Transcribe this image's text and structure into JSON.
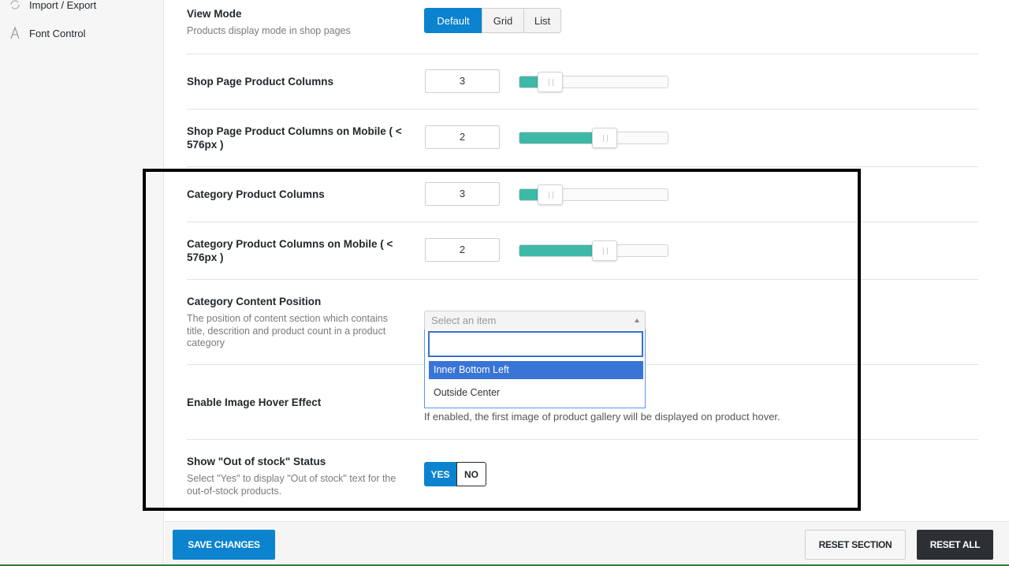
{
  "sidebar": {
    "items": [
      {
        "label": "Import / Export",
        "icon": "refresh-icon"
      },
      {
        "label": "Font Control",
        "icon": "font-icon"
      }
    ]
  },
  "settings": {
    "view_mode": {
      "label": "View Mode",
      "description": "Products display mode in shop pages",
      "options": [
        "Default",
        "Grid",
        "List"
      ],
      "selected": "Default"
    },
    "shop_cols": {
      "label": "Shop Page Product Columns",
      "value": "3",
      "fraction": 0.06
    },
    "shop_cols_mobile": {
      "label_line1": "Shop Page Product Columns on Mobile ( <",
      "label_line2": "576px )",
      "value": "2",
      "fraction": 0.5
    },
    "cat_cols": {
      "label": "Category Product Columns",
      "value": "3",
      "fraction": 0.06
    },
    "cat_cols_mobile": {
      "label_line1": "Category Product Columns on Mobile ( <",
      "label_line2": "576px )",
      "value": "2",
      "fraction": 0.5
    },
    "cat_content_position": {
      "label": "Category Content Position",
      "description_lines": [
        "The position of content section which contains",
        "title, descrition and product count in a product",
        "category"
      ],
      "placeholder": "Select an item",
      "search_value": "",
      "options": [
        "Inner Bottom Left",
        "Outside Center"
      ],
      "highlighted": "Inner Bottom Left"
    },
    "image_hover": {
      "label": "Enable Image Hover Effect",
      "help": "If enabled, the first image of product gallery will be displayed on product hover."
    },
    "out_of_stock": {
      "label": "Show \"Out of stock\" Status",
      "description_lines": [
        "Select \"Yes\" to display \"Out of stock\" text for the",
        "out-of-stock products."
      ],
      "yes_label": "YES",
      "no_label": "NO",
      "selected": "YES"
    }
  },
  "footer": {
    "save_label": "SAVE CHANGES",
    "reset_section_label": "RESET SECTION",
    "reset_all_label": "RESET ALL"
  },
  "colors": {
    "accent": "#0b83cf",
    "slider_fill": "#3eb9a7",
    "dropdown_highlight": "#3875d7",
    "dark_button": "#2c3034"
  }
}
